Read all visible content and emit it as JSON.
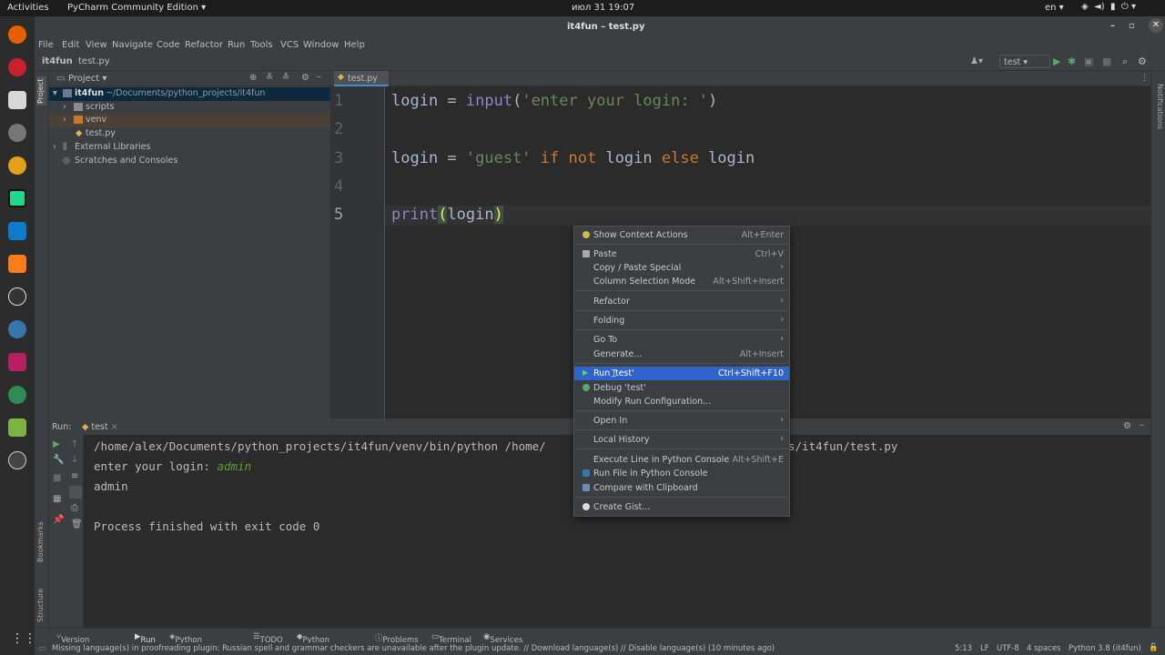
{
  "topbar": {
    "activities": "Activities",
    "app": "PyCharm Community Edition",
    "clock": "июл 31  19:07",
    "lang": "en"
  },
  "window": {
    "title": "it4fun – test.py"
  },
  "menu": [
    "File",
    "Edit",
    "View",
    "Navigate",
    "Code",
    "Refactor",
    "Run",
    "Tools",
    "VCS",
    "Window",
    "Help"
  ],
  "nav": {
    "project": "it4fun",
    "file": "test.py",
    "run_config": "test"
  },
  "project_panel": {
    "title": "Project",
    "root": "it4fun",
    "root_path": "~/Documents/python_projects/it4fun",
    "items": [
      "scripts",
      "venv",
      "test.py"
    ],
    "external": "External Libraries",
    "scratches": "Scratches and Consoles"
  },
  "side_labels": {
    "project": "Project",
    "bookmarks": "Bookmarks",
    "structure": "Structure",
    "notifications": "Notifications"
  },
  "editor": {
    "tab": "test.py",
    "line_numbers": [
      "1",
      "2",
      "3",
      "4",
      "5"
    ]
  },
  "run_panel": {
    "label": "Run:",
    "tab": "test",
    "lines": [
      "/home/alex/Documents/python_projects/it4fun/venv/bin/python /home/",
      "enter your login: ",
      "admin",
      "",
      "Process finished with exit code 0"
    ],
    "input_echo": "admin",
    "path_tail": "s/it4fun/test.py"
  },
  "context_menu": [
    {
      "label": "Show Context Actions",
      "shortcut": "Alt+Enter",
      "icon": "bulb-icon"
    },
    {
      "label": "Paste",
      "shortcut": "Ctrl+V",
      "icon": "paste-icon"
    },
    {
      "label": "Copy / Paste Special",
      "shortcut": "",
      "submenu": true
    },
    {
      "label": "Column Selection Mode",
      "shortcut": "Alt+Shift+Insert"
    },
    {
      "label": "Refactor",
      "shortcut": "",
      "submenu": true
    },
    {
      "label": "Folding",
      "shortcut": "",
      "submenu": true
    },
    {
      "label": "Go To",
      "shortcut": "",
      "submenu": true
    },
    {
      "label": "Generate...",
      "shortcut": "Alt+Insert"
    },
    {
      "label": "Run 'test'",
      "shortcut": "Ctrl+Shift+F10",
      "icon": "run-icon",
      "selected": true
    },
    {
      "label": "Debug 'test'",
      "shortcut": "",
      "icon": "debug-icon"
    },
    {
      "label": "Modify Run Configuration...",
      "shortcut": ""
    },
    {
      "label": "Open In",
      "shortcut": "",
      "submenu": true
    },
    {
      "label": "Local History",
      "shortcut": "",
      "submenu": true
    },
    {
      "label": "Execute Line in Python Console",
      "shortcut": "Alt+Shift+E"
    },
    {
      "label": "Run File in Python Console",
      "shortcut": "",
      "icon": "python-icon"
    },
    {
      "label": "Compare with Clipboard",
      "shortcut": "",
      "icon": "compare-icon"
    },
    {
      "label": "Create Gist...",
      "shortcut": "",
      "icon": "github-icon"
    }
  ],
  "bottom_tabs": [
    "Version Control",
    "Run",
    "Python Packages",
    "TODO",
    "Python Console",
    "Problems",
    "Terminal",
    "Services"
  ],
  "status": {
    "message": "Missing language(s) in proofreading plugin: Russian spell and grammar checkers are unavailable after the plugin update. // Download language(s) // Disable language(s) (10 minutes ago)",
    "pos": "5:13",
    "lf": "LF",
    "enc": "UTF-8",
    "indent": "4 spaces",
    "interp": "Python 3.8 (it4fun)"
  },
  "colors": {
    "keyword": "#cc7832",
    "string": "#6a8759",
    "selection": "#2f65ca",
    "input_green": "#5f9f2f"
  }
}
